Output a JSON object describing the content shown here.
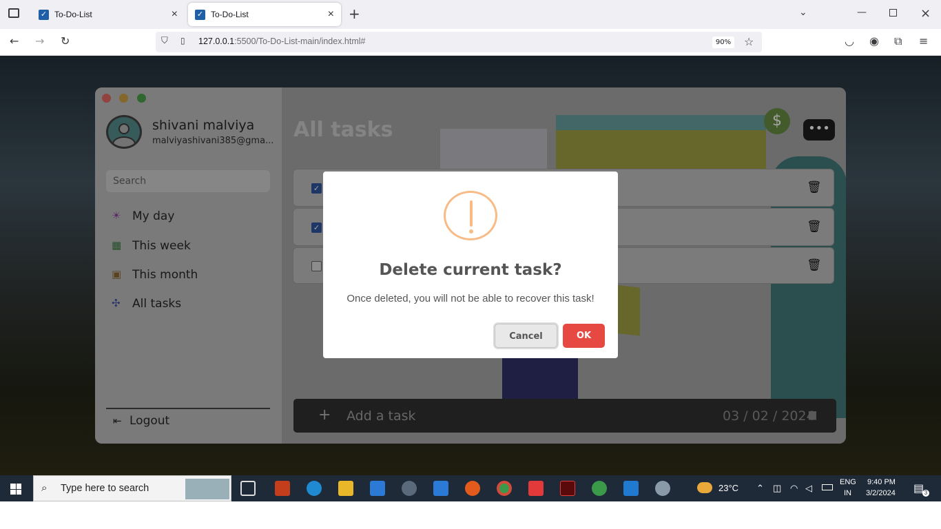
{
  "browser": {
    "tabs": [
      {
        "title": "To-Do-List",
        "active": false
      },
      {
        "title": "To-Do-List",
        "active": true
      }
    ],
    "new_tab": "+",
    "url_host": "127.0.0.1",
    "url_path": ":5500/To-Do-List-main/index.html#",
    "zoom": "90%"
  },
  "app": {
    "user": {
      "name": "shivani malviya",
      "email": "malviyashivani385@gma..."
    },
    "search_placeholder": "Search",
    "nav": [
      {
        "label": "My day",
        "icon": "sun-icon"
      },
      {
        "label": "This week",
        "icon": "grid-calendar-icon"
      },
      {
        "label": "This month",
        "icon": "calendar-icon"
      },
      {
        "label": "All tasks",
        "icon": "puzzle-icon"
      }
    ],
    "logout": "Logout",
    "main_title": "All tasks",
    "tasks": [
      {
        "checked": true
      },
      {
        "checked": true
      },
      {
        "checked": false
      }
    ],
    "add_task": {
      "plus": "+",
      "placeholder": "Add a task",
      "date": "03 / 02 / 2024"
    },
    "illustration_text": "$"
  },
  "dialog": {
    "title": "Delete current task?",
    "text": "Once deleted, you will not be able to recover this task!",
    "cancel": "Cancel",
    "ok": "OK",
    "icon_color": "#f8bb86",
    "ok_color": "#e64942"
  },
  "taskbar": {
    "search_placeholder": "Type here to search",
    "weather": "23°C",
    "lang_top": "ENG",
    "lang_bottom": "IN",
    "time": "9:40 PM",
    "date": "3/2/2024",
    "notifications": "3"
  }
}
